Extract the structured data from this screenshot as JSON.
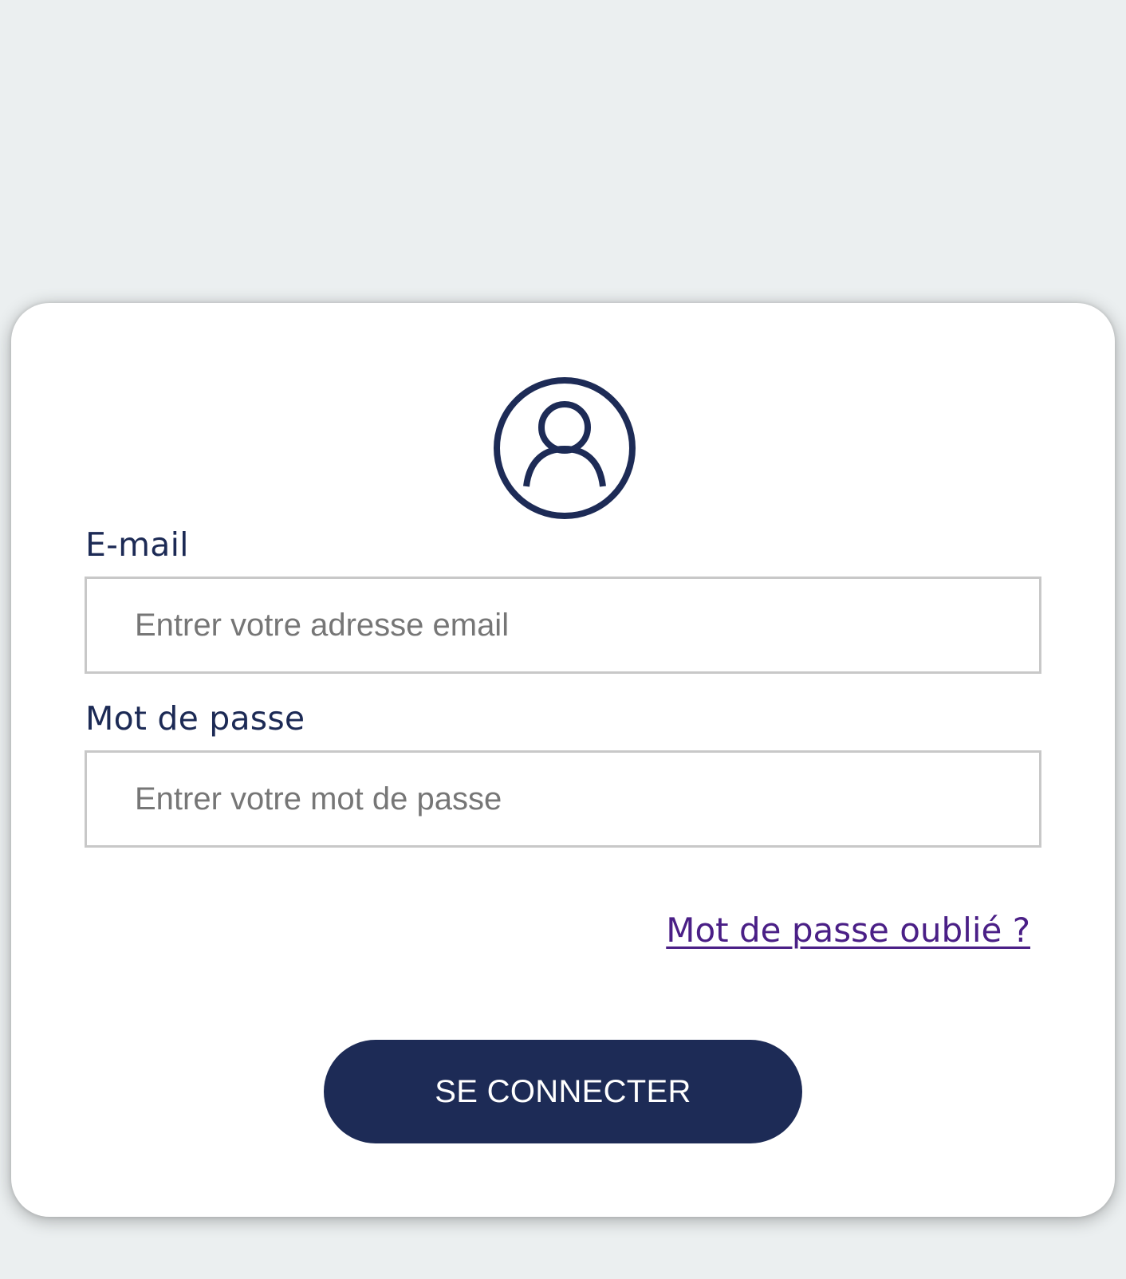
{
  "login": {
    "avatar_icon": "user-circle-icon",
    "email_label": "E-mail",
    "email_placeholder": "Entrer votre adresse email",
    "email_value": "",
    "password_label": "Mot de passe",
    "password_placeholder": "Entrer votre mot de passe",
    "password_value": "",
    "forgot_link": "Mot de passe oublié ?",
    "submit_label": "SE CONNECTER"
  },
  "colors": {
    "page_background": "#ebeff0",
    "card_background": "#ffffff",
    "primary": "#1d2b56",
    "link": "#4a1f86",
    "input_border": "#c8c8c8",
    "placeholder": "#767676"
  }
}
